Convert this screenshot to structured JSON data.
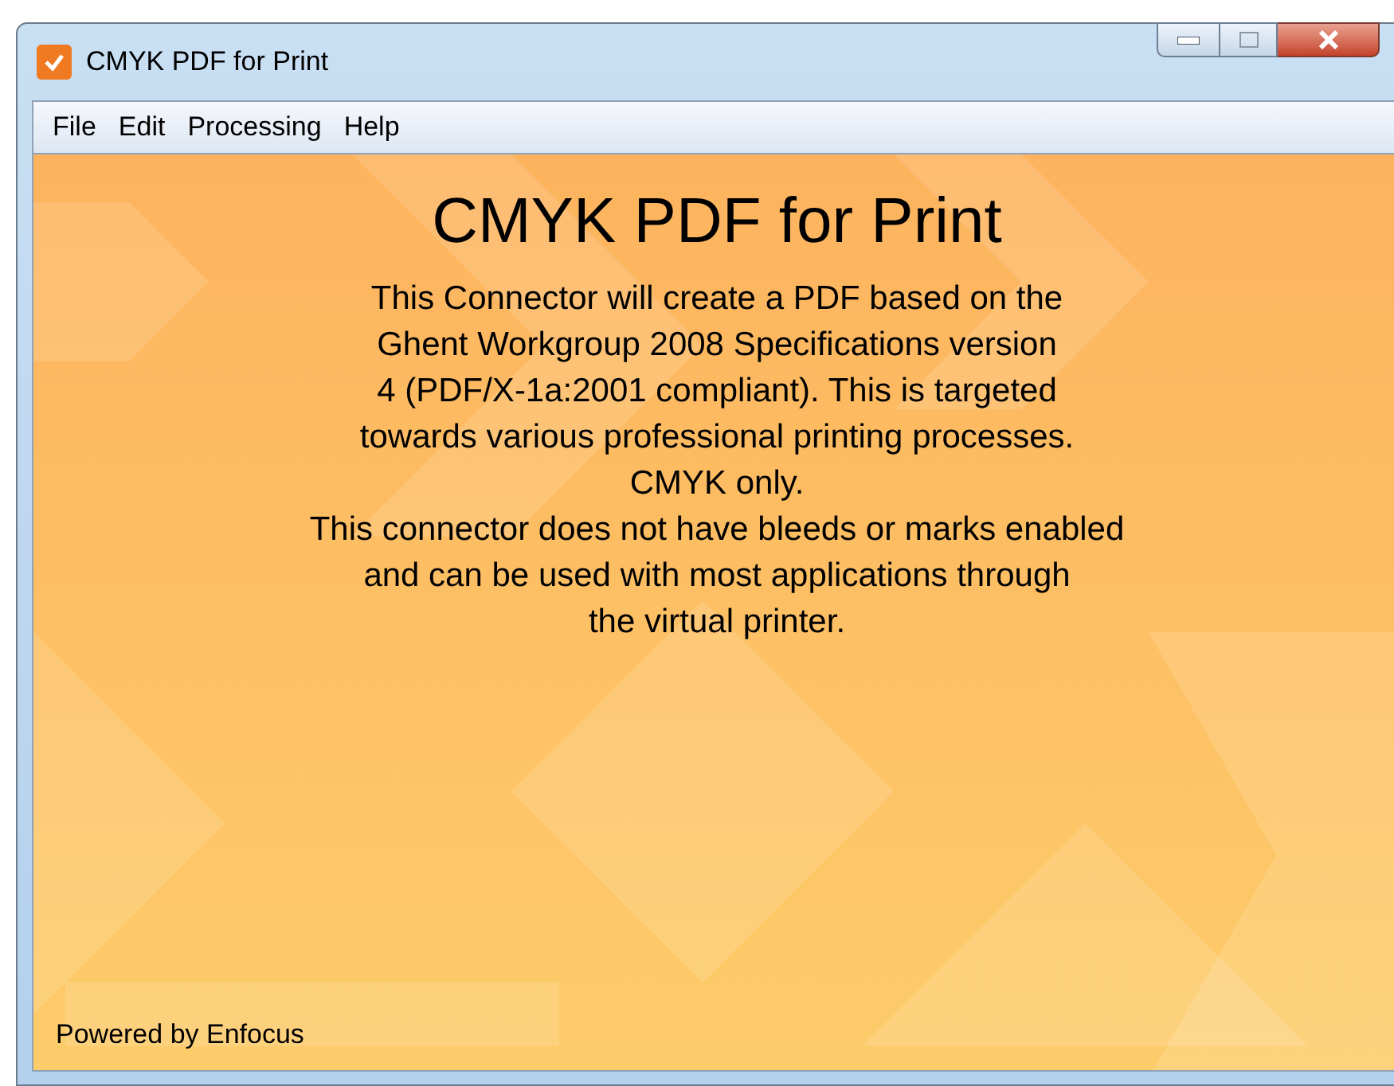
{
  "window": {
    "title": "CMYK PDF for Print"
  },
  "menu": [
    {
      "label": "File"
    },
    {
      "label": "Edit"
    },
    {
      "label": "Processing"
    },
    {
      "label": "Help"
    }
  ],
  "content": {
    "heading": "CMYK PDF for Print",
    "description_lines": [
      "This Connector will create a PDF based on the",
      "Ghent Workgroup 2008 Specifications version",
      "4 (PDF/X-1a:2001 compliant). This is targeted",
      "towards various professional printing processes.",
      "CMYK only.",
      "This connector does not have bleeds or marks enabled",
      "and can be used with most applications through",
      "the virtual printer."
    ],
    "footer": "Powered by Enfocus"
  }
}
